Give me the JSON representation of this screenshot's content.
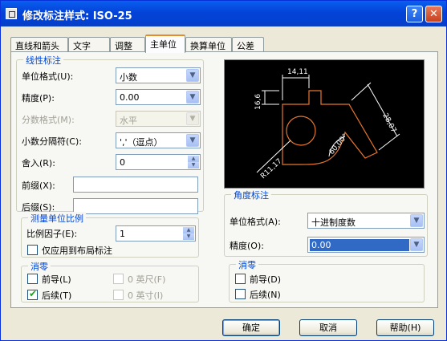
{
  "window": {
    "title": "修改标注样式: ISO-25",
    "help_glyph": "?",
    "close_glyph": "✕"
  },
  "tabs": [
    "直线和箭头",
    "文字",
    "调整",
    "主单位",
    "换算单位",
    "公差"
  ],
  "active_tab": "主单位",
  "linear": {
    "title": "线性标注",
    "unit_format_label": "单位格式(U):",
    "unit_format_value": "小数",
    "precision_label": "精度(P):",
    "precision_value": "0.00",
    "fraction_format_label": "分数格式(M):",
    "fraction_format_value": "水平",
    "decimal_sep_label": "小数分隔符(C):",
    "decimal_sep_value": "','（逗点）",
    "round_off_label": "舍入(R):",
    "round_off_value": "0",
    "prefix_label": "前缀(X):",
    "prefix_value": "",
    "suffix_label": "后缀(S):",
    "suffix_value": ""
  },
  "scale": {
    "title": "测量单位比例",
    "factor_label": "比例因子(E):",
    "factor_value": "1",
    "layout_only_label": "仅应用到布局标注",
    "layout_only_checked": false
  },
  "zero_left": {
    "title": "消零",
    "leading_label": "前导(L)",
    "leading_checked": false,
    "trailing_label": "后续(T)",
    "trailing_checked": true,
    "feet_label": "0 英尺(F)",
    "inches_label": "0 英寸(I)"
  },
  "angular": {
    "title": "角度标注",
    "unit_format_label": "单位格式(A):",
    "unit_format_value": "十进制度数",
    "precision_label": "精度(O):",
    "precision_value": "0.00"
  },
  "zero_right": {
    "title": "消零",
    "leading_label": "前导(D)",
    "leading_checked": false,
    "trailing_label": "后续(N)",
    "trailing_checked": false
  },
  "preview": {
    "dim_top": "14,11",
    "dim_left": "16,6",
    "dim_right": "28,07",
    "dim_angle": "60,00°",
    "dim_radius": "R11,17",
    "colors": {
      "bg": "#000000",
      "outline": "#e8772e",
      "dim": "#ffffff"
    }
  },
  "buttons": {
    "ok": "确定",
    "cancel": "取消",
    "help": "帮助(H)"
  },
  "icons": {
    "combo_arrow": "▼",
    "spin_up": "▲",
    "spin_down": "▼",
    "check": "✔"
  }
}
